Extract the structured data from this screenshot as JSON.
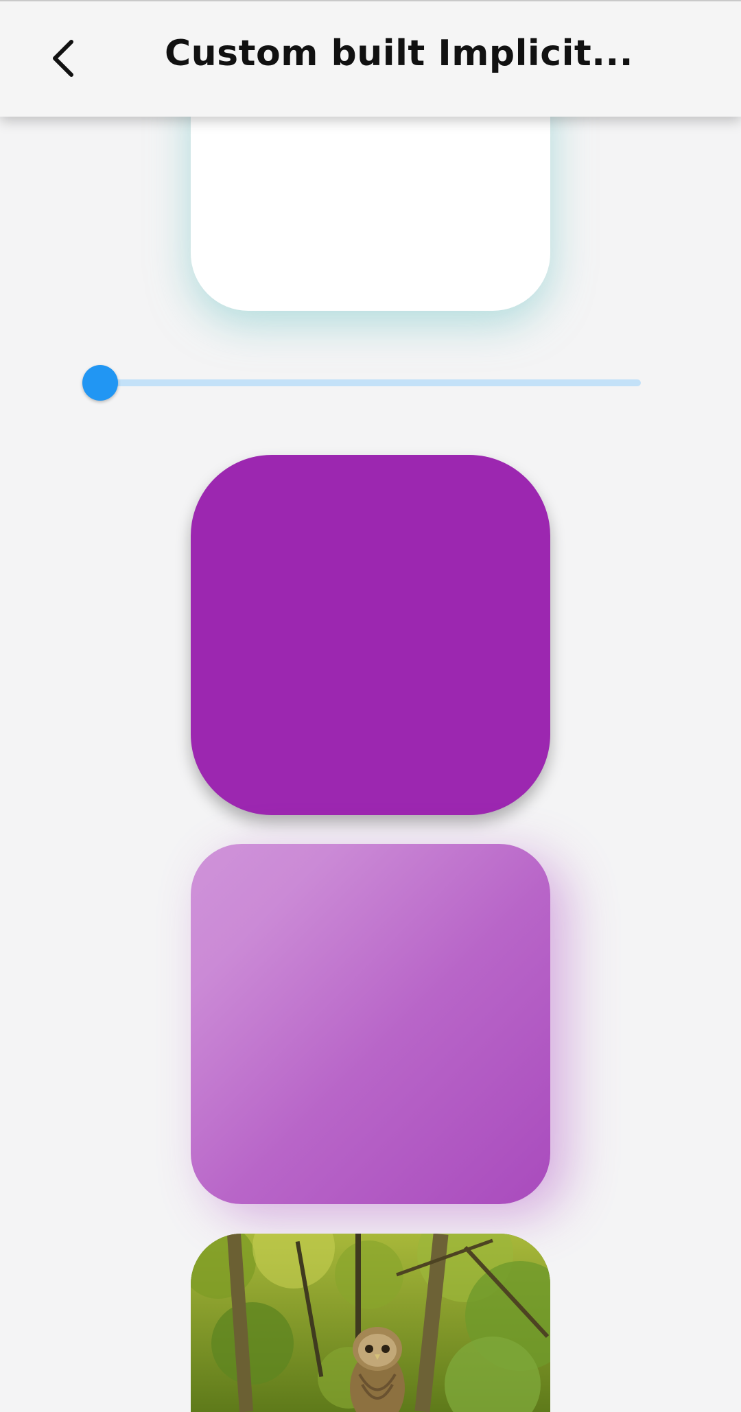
{
  "appbar": {
    "title": "Custom built Implicit...",
    "back_icon": "arrow-back-icon"
  },
  "slider": {
    "value": 0,
    "min": 0,
    "max": 1,
    "track_color": "#c3e1f8",
    "active_color": "#2196f3"
  },
  "boxes": {
    "white_box_color": "#ffffff",
    "white_box_shadow_color": "#a8dcdc",
    "purple_box_color": "#9c27b0",
    "gradient_box_colors": [
      "#cf93d9",
      "#a94bbd"
    ],
    "image_box_subject": "owl-in-forest-image"
  },
  "colors": {
    "background": "#f4f4f5",
    "appbar": "#f5f5f5"
  }
}
